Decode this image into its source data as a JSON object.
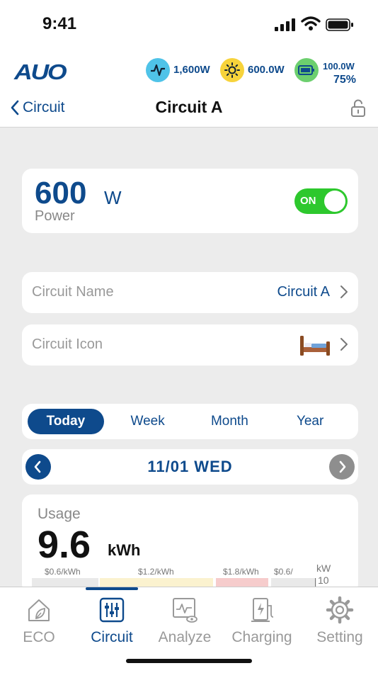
{
  "status_bar": {
    "time": "9:41"
  },
  "header": {
    "logo": "AUO",
    "stats": [
      {
        "icon": "pulse-icon",
        "value": "1,600W",
        "color": "#4fc3e8"
      },
      {
        "icon": "sun-icon",
        "value": "600.0W",
        "color": "#f7d33b"
      },
      {
        "icon": "battery-icon",
        "value": "100.0W",
        "sub": "75%",
        "color": "#6ccf6e"
      }
    ],
    "back_label": "Circuit",
    "title": "Circuit A"
  },
  "power_card": {
    "value": "600",
    "unit": "W",
    "label": "Power",
    "toggle_label": "ON"
  },
  "settings": {
    "name_label": "Circuit Name",
    "name_value": "Circuit A",
    "icon_label": "Circuit Icon",
    "icon_value": "bed-icon"
  },
  "period_tabs": [
    "Today",
    "Week",
    "Month",
    "Year"
  ],
  "period_active": "Today",
  "date": "11/01 WED",
  "usage": {
    "label": "Usage",
    "value": "9.6",
    "unit": "kWh",
    "rates": [
      "$0.6/kWh",
      "$1.2/kWh",
      "$1.8/kWh",
      "$0.6/"
    ],
    "axis_unit": "kW",
    "axis_max": "10"
  },
  "tab_bar": [
    {
      "label": "ECO",
      "icon": "eco-house-icon"
    },
    {
      "label": "Circuit",
      "icon": "sliders-icon"
    },
    {
      "label": "Analyze",
      "icon": "analyze-icon"
    },
    {
      "label": "Charging",
      "icon": "charging-station-icon"
    },
    {
      "label": "Setting",
      "icon": "gear-icon"
    }
  ],
  "tab_active": "Circuit"
}
